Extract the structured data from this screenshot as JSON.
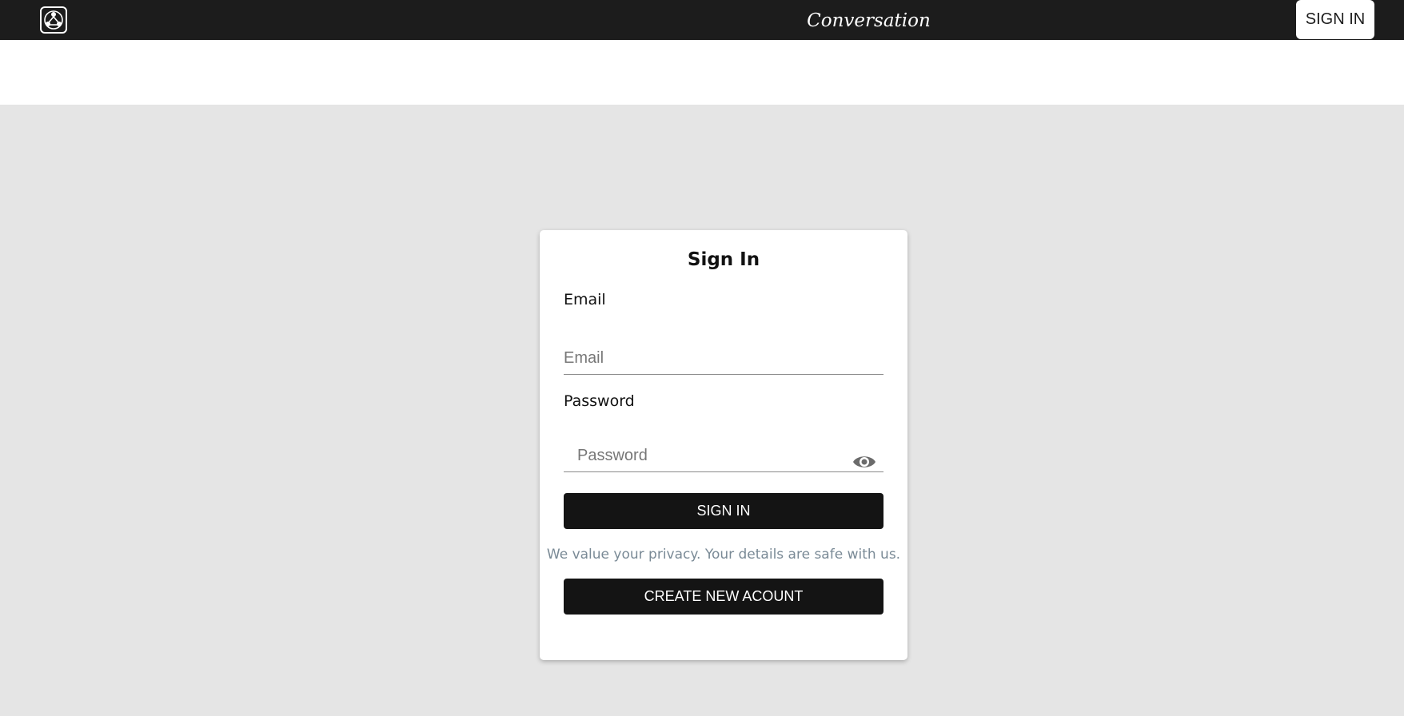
{
  "header": {
    "app_title": "Conversation",
    "signin_label": "SIGN IN",
    "logo_icon": "conversation-logo-icon"
  },
  "signin_card": {
    "title": "Sign In",
    "email_label": "Email",
    "email_placeholder": "Email",
    "email_value": "",
    "password_label": "Password",
    "password_placeholder": "Password",
    "password_value": "",
    "toggle_icon": "eye-icon",
    "submit_label": "SIGN IN",
    "privacy_text": "We value your privacy. Your details are safe with us.",
    "create_account_label": "CREATE NEW ACOUNT"
  },
  "colors": {
    "header_bg": "#1c1c1c",
    "page_bg": "#e5e5e5",
    "button_bg": "#141414",
    "privacy_text": "#7a8a96"
  }
}
